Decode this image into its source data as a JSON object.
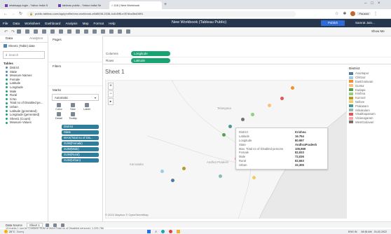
{
  "browser": {
    "tabs": [
      {
        "label": "whatsapp-login - Yahoo India S"
      },
      {
        "label": "tableau public - Yahoo India Se"
      },
      {
        "label": "⌂ 118 | New Workbook"
      }
    ],
    "url": "public.tableau.com/app/profile/new-workbook-a9d8008-1536-4c8-8ff8-e3f7dba3bd0891",
    "profile": "Paused"
  },
  "menu": {
    "items": [
      "File",
      "Data",
      "Worksheet",
      "Dashboard",
      "Analysis",
      "Map",
      "Format",
      "Help"
    ],
    "title": "New Workbook (Tableau Public)",
    "publish": "Publish",
    "user": "Samrat Jain..."
  },
  "toolbar": {
    "show_me": "Show Me"
  },
  "data_pane": {
    "tabs": [
      "Data",
      "Analytics"
    ],
    "source": "Sheet1 (Table) data",
    "search_placeholder": "Search",
    "tables_header": "Tables",
    "fields": [
      "District",
      "State",
      "Measure Names",
      "Female",
      "Latitude",
      "Longitude",
      "Male",
      "Rural",
      "S.No",
      "Total no of Disabled pe...",
      "Urban",
      "Latitude (generated)",
      "Longitude (generated)",
      "Sheet1 (Count)",
      "Measure Values"
    ]
  },
  "cards": {
    "pages": "Pages",
    "filters": "Filters",
    "marks": "Marks",
    "mark_type": "Automatic",
    "mark_buttons": [
      "Color",
      "Size",
      "Label",
      "Detail",
      "Tooltip"
    ],
    "mark_fields": [
      "District",
      "State",
      "MAX(Total no of Dis...",
      "SUM(Female)",
      "SUM(Male)",
      "SUM(Rural)",
      "SUM(Urban)"
    ]
  },
  "shelves": {
    "columns_label": "Columns",
    "rows_label": "Rows",
    "columns_value": "Longitude",
    "rows_value": "Latitude"
  },
  "sheet": {
    "title": "Sheet 1"
  },
  "map": {
    "labels": [
      "Telangana",
      "Karnataka",
      "Andhra Pradesh"
    ],
    "attribution": "© 2022 Mapbox  © OpenStreetMap"
  },
  "tooltip": {
    "rows": [
      {
        "k": "District",
        "v": "Krishna"
      },
      {
        "k": "Latitude",
        "v": "16.754"
      },
      {
        "k": "Longitude",
        "v": "80.997"
      },
      {
        "k": "State",
        "v": "AndhraPradesh"
      },
      {
        "k": "Max. Total no of Disabled persons",
        "v": "105,969"
      },
      {
        "k": "Female",
        "v": "82,933"
      },
      {
        "k": "Male",
        "v": "72,036"
      },
      {
        "k": "Rural",
        "v": "82,663"
      },
      {
        "k": "Urban",
        "v": "32,306"
      }
    ]
  },
  "legend": {
    "title": "District",
    "items": [
      {
        "label": "Anantapur",
        "color": "#4e79a7"
      },
      {
        "label": "Chittoor",
        "color": "#a0cbe8"
      },
      {
        "label": "EastGodavari",
        "color": "#f28e2b"
      },
      {
        "label": "Guntur",
        "color": "#ffbe7d"
      },
      {
        "label": "Kadapa",
        "color": "#59a14f"
      },
      {
        "label": "Krishna",
        "color": "#8cd17d"
      },
      {
        "label": "Kurnool",
        "color": "#b6992d"
      },
      {
        "label": "Nellore",
        "color": "#f1ce63"
      },
      {
        "label": "Prakasam",
        "color": "#499894"
      },
      {
        "label": "Srikakulam",
        "color": "#86bcb6"
      },
      {
        "label": "Visakhapatnam",
        "color": "#e15759"
      },
      {
        "label": "Vizianagaram",
        "color": "#ff9d9a"
      },
      {
        "label": "WestGodavari",
        "color": "#79706e"
      }
    ]
  },
  "bottom": {
    "tabs": [
      "Data Source",
      "Sheet 1"
    ],
    "status": "13 marks  1 row by 1 column  SUM of MAX(Total no of Disabled persons): 1,225,786"
  },
  "taskbar": {
    "weather_temp": "26°C",
    "weather_desc": "Sunny",
    "lang": "ENG IN",
    "time": "08:38 AM",
    "date": "24-02-2022"
  }
}
